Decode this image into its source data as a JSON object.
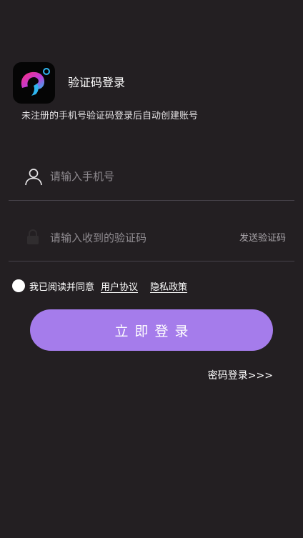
{
  "header": {
    "logo_icon": "app-logo",
    "title": "验证码登录",
    "subtitle": "未注册的手机号验证码登录后自动创建账号"
  },
  "phone": {
    "icon": "user-icon",
    "placeholder": "请输入手机号",
    "value": ""
  },
  "code": {
    "placeholder": "请输入收到的验证码",
    "value": "",
    "send_label": "发送验证码"
  },
  "agreement": {
    "checked": false,
    "prefix": "我已阅读并同意",
    "user_agreement": "用户协议",
    "privacy_policy": "隐私政策"
  },
  "login_button": "立即登录",
  "password_login": "密码登录>>>",
  "colors": {
    "background": "#231f22",
    "accent": "#a57ceb"
  }
}
